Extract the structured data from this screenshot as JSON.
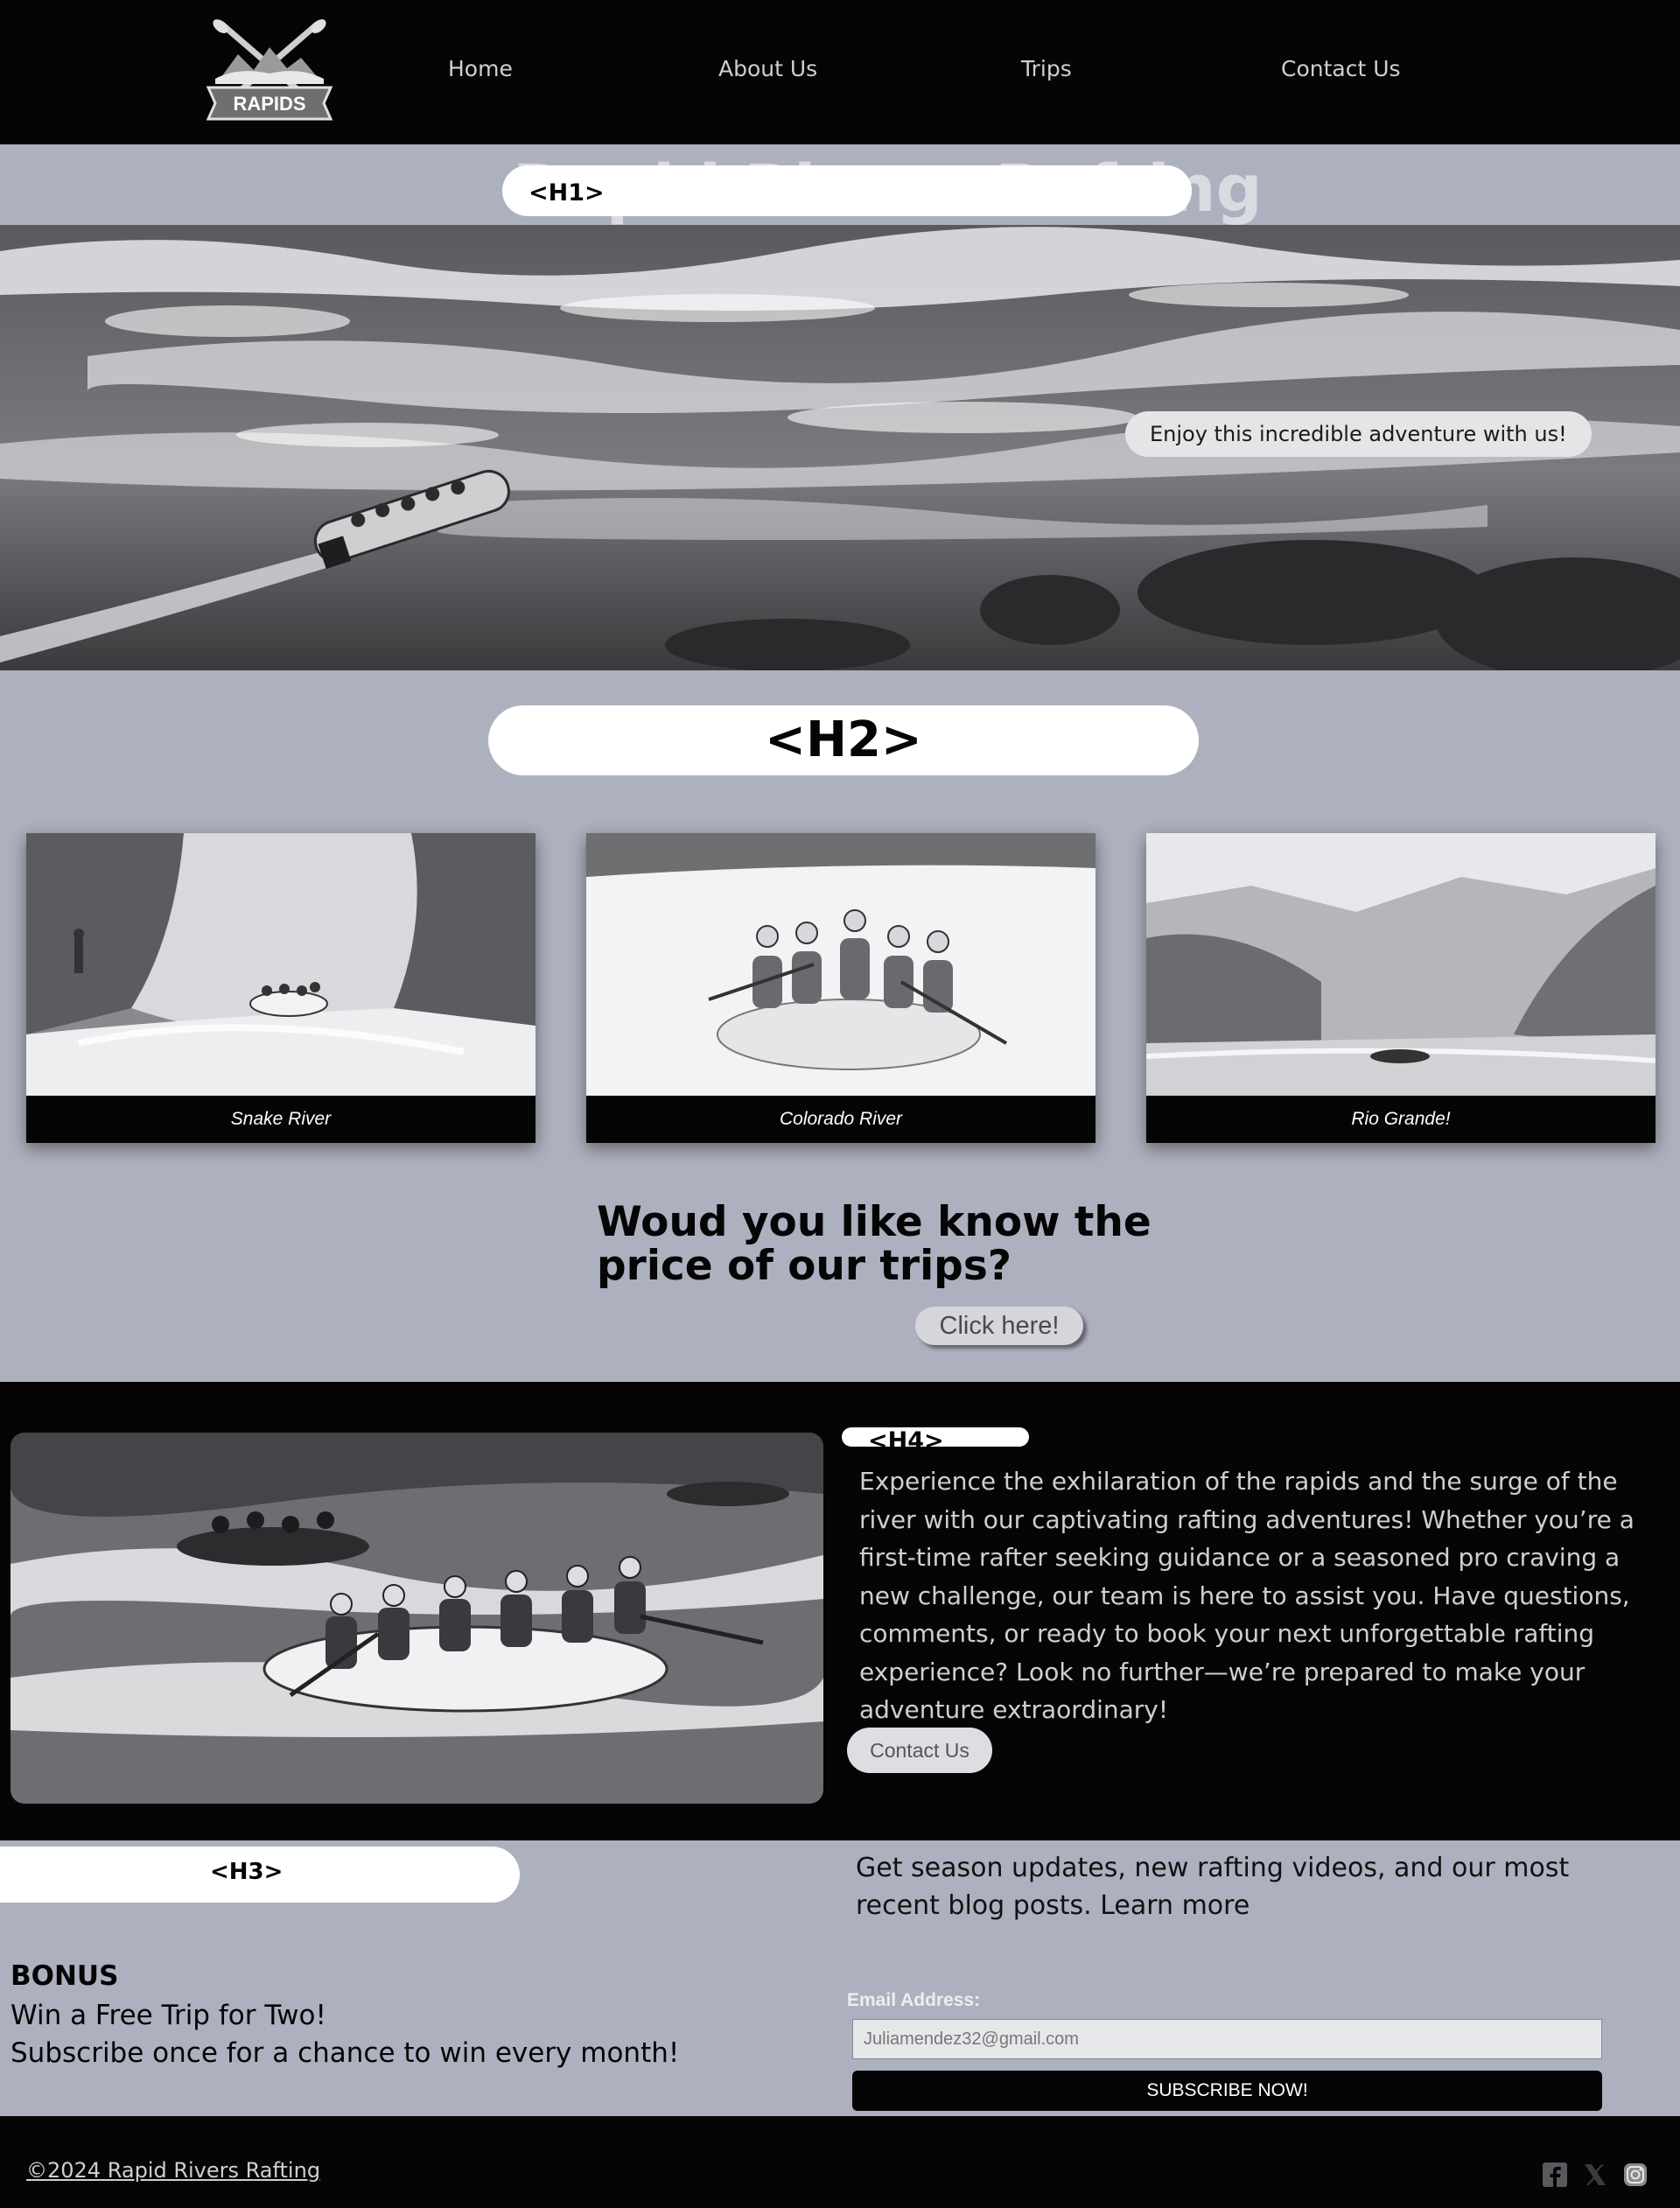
{
  "nav": {
    "logo_text": "RAPIDS",
    "links": [
      {
        "label": "Home"
      },
      {
        "label": "About Us"
      },
      {
        "label": "Trips"
      },
      {
        "label": "Contact Us"
      }
    ]
  },
  "h1": {
    "tag": "<H1>",
    "ghost_text": "Rapid Rivers Rafting"
  },
  "hero": {
    "callout": "Enjoy this incredible adventure with us!"
  },
  "h2": {
    "tag": "<H2>"
  },
  "trips": [
    {
      "caption": "Snake River"
    },
    {
      "caption": "Colorado River"
    },
    {
      "caption": "Rio Grande!"
    }
  ],
  "pricing": {
    "question": "Woud you like know the price of our trips?",
    "button": "Click here!"
  },
  "feature": {
    "tag": "<H4>",
    "text": "Experience the exhilaration of the rapids and the surge of the river with our captivating rafting adventures! Whether you’re a first-time rafter seeking guidance or a seasoned pro craving a new challenge, our team is here to assist you. Have questions, comments, or ready to book your next unforgettable rafting experience? Look no further—we’re prepared to make your adventure extraordinary!",
    "button": "Contact Us"
  },
  "subscribe": {
    "tag": "<H3>",
    "updates": "Get season updates, new rafting videos, and our most recent blog posts. Learn more",
    "bonus_title": "BONUS",
    "bonus_line1": "Win a Free Trip for Two!",
    "bonus_line2": "Subscribe once for a chance to win every month!",
    "email_label": "Email Address:",
    "email_value": "Juliamendez32@gmail.com",
    "button": "SUBSCRIBE NOW!"
  },
  "footer": {
    "copyright": "©2024 Rapid Rivers Rafting",
    "social_icons": [
      "facebook-icon",
      "x-icon",
      "instagram-icon"
    ]
  }
}
